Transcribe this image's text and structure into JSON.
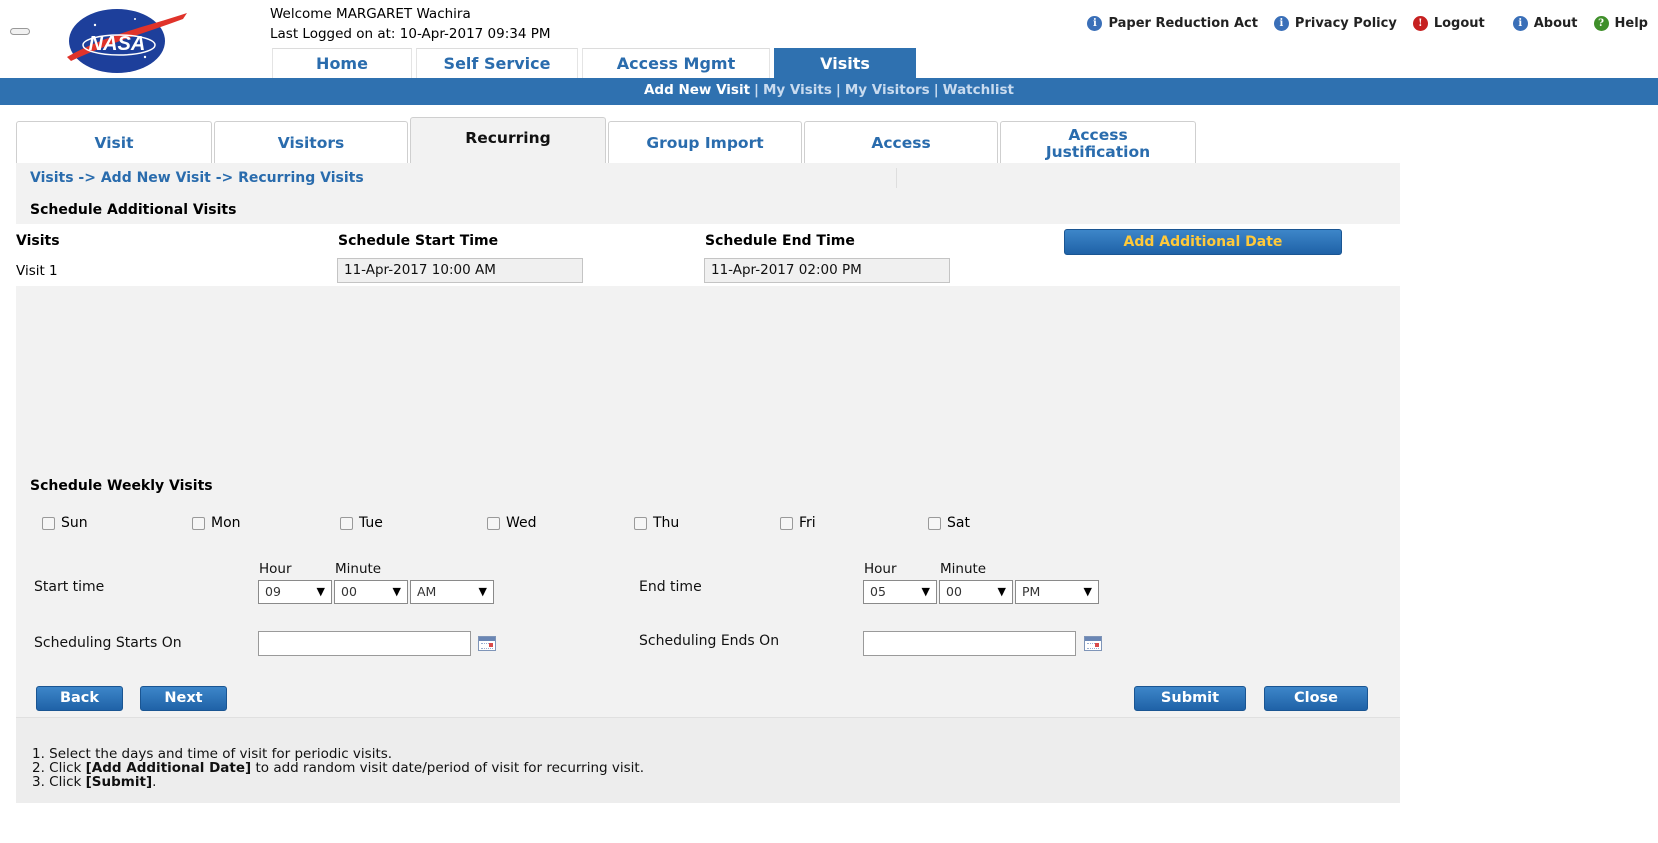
{
  "header": {
    "welcome": "Welcome MARGARET Wachira",
    "last_logged": "Last Logged on at: 10-Apr-2017 09:34 PM",
    "logo_text": "NASA",
    "links": [
      {
        "label": "Paper Reduction Act",
        "icon": "info-icon"
      },
      {
        "label": "Privacy Policy",
        "icon": "info-icon"
      },
      {
        "label": "Logout",
        "icon": "alert-icon"
      },
      {
        "label": "About",
        "icon": "info-icon"
      },
      {
        "label": "Help",
        "icon": "help-icon"
      }
    ]
  },
  "main_tabs": [
    "Home",
    "Self Service",
    "Access Mgmt",
    "Visits"
  ],
  "subnav": [
    "Add New Visit",
    "My Visits",
    "My Visitors",
    "Watchlist"
  ],
  "sec_tabs": [
    "Visit",
    "Visitors",
    "Recurring",
    "Group Import",
    "Access",
    "Access Justification"
  ],
  "sec_tab_access_line1": "Access",
  "sec_tab_access_line2": "Justification",
  "breadcrumb": "Visits -> Add New Visit -> Recurring Visits",
  "additional": {
    "heading": "Schedule Additional Visits",
    "col_visits": "Visits",
    "col_start": "Schedule Start Time",
    "col_end": "Schedule End Time",
    "add_button": "Add Additional Date",
    "rows": [
      {
        "label": "Visit 1",
        "start": "11-Apr-2017 10:00 AM",
        "end": "11-Apr-2017 02:00 PM"
      }
    ]
  },
  "weekly": {
    "heading": "Schedule Weekly Visits",
    "days": [
      "Sun",
      "Mon",
      "Tue",
      "Wed",
      "Thu",
      "Fri",
      "Sat"
    ],
    "start_label": "Start time",
    "end_label": "End time",
    "hour_label": "Hour",
    "minute_label": "Minute",
    "start_hour": "09",
    "start_minute": "00",
    "start_ampm": "AM",
    "end_hour": "05",
    "end_minute": "00",
    "end_ampm": "PM",
    "starts_on_label": "Scheduling Starts On",
    "ends_on_label": "Scheduling Ends On",
    "starts_on_value": "",
    "ends_on_value": ""
  },
  "buttons": {
    "back": "Back",
    "next": "Next",
    "submit": "Submit",
    "close": "Close"
  },
  "instructions": {
    "line1": "1. Select the days and time of visit for periodic visits.",
    "line2_pre": "2. Click ",
    "line2_bold": "[Add Additional Date]",
    "line2_post": " to add random visit date/period of visit for recurring visit.",
    "line3_pre": "3. Click ",
    "line3_bold": "[Submit]",
    "line3_post": "."
  },
  "colors": {
    "brand_blue": "#2f71b0",
    "link_blue": "#2a6cad",
    "add_button_text": "#ffc93a",
    "panel_bg": "#f2f2f2"
  }
}
